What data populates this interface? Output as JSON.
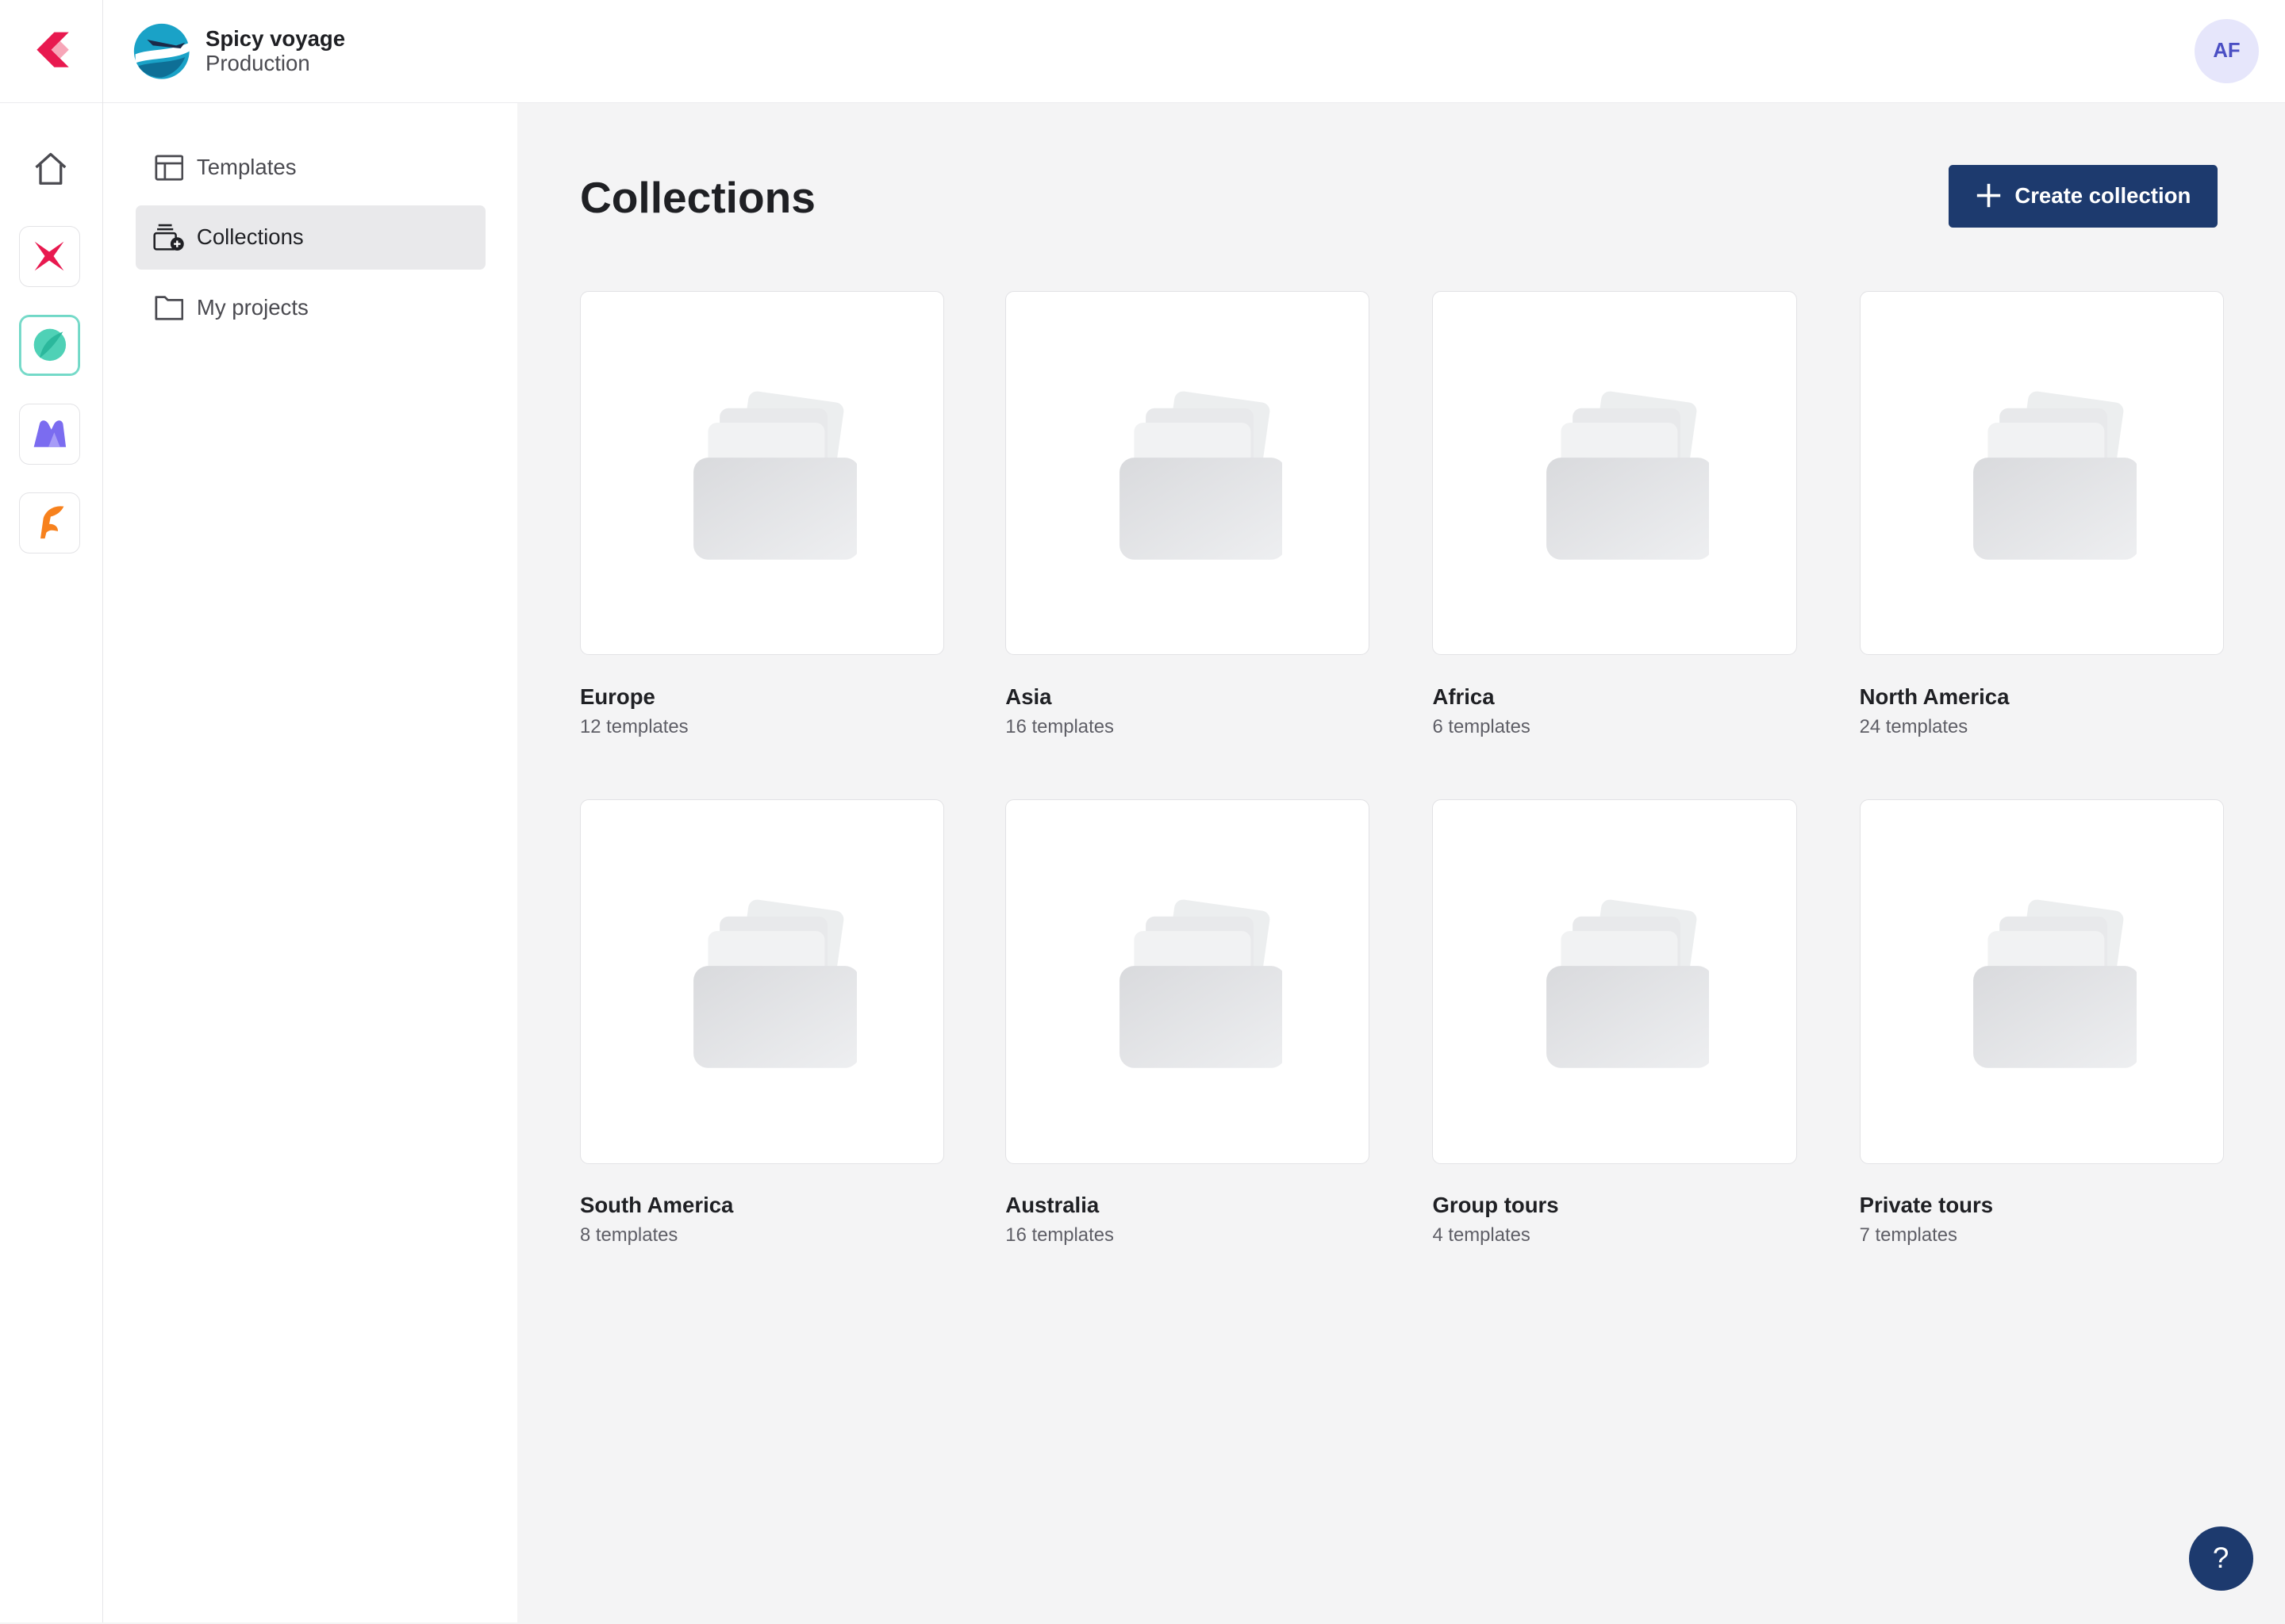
{
  "workspace": {
    "name": "Spicy voyage",
    "environment": "Production"
  },
  "user": {
    "initials": "AF"
  },
  "rail": {
    "icons": [
      "app-logo-icon",
      "home-icon",
      "spark-app-icon",
      "leaf-app-icon",
      "wave-app-icon",
      "feather-app-icon"
    ]
  },
  "sidebar": {
    "items": [
      {
        "label": "Templates",
        "icon": "templates-icon"
      },
      {
        "label": "Collections",
        "icon": "collections-icon",
        "active": true
      },
      {
        "label": "My projects",
        "icon": "folder-icon"
      }
    ]
  },
  "main": {
    "title": "Collections",
    "create_label": "Create collection",
    "collections": [
      {
        "name": "Europe",
        "count": "12 templates"
      },
      {
        "name": "Asia",
        "count": "16 templates"
      },
      {
        "name": "Africa",
        "count": "6 templates"
      },
      {
        "name": "North America",
        "count": "24 templates"
      },
      {
        "name": "South America",
        "count": "8 templates"
      },
      {
        "name": "Australia",
        "count": "16 templates"
      },
      {
        "name": "Group tours",
        "count": "4 templates"
      },
      {
        "name": "Private tours",
        "count": "7 templates"
      }
    ]
  },
  "help_label": "?",
  "colors": {
    "primary": "#1d3a6e",
    "accent_avatar": "#e6e6fb",
    "active_nav": "#e9e9eb"
  }
}
